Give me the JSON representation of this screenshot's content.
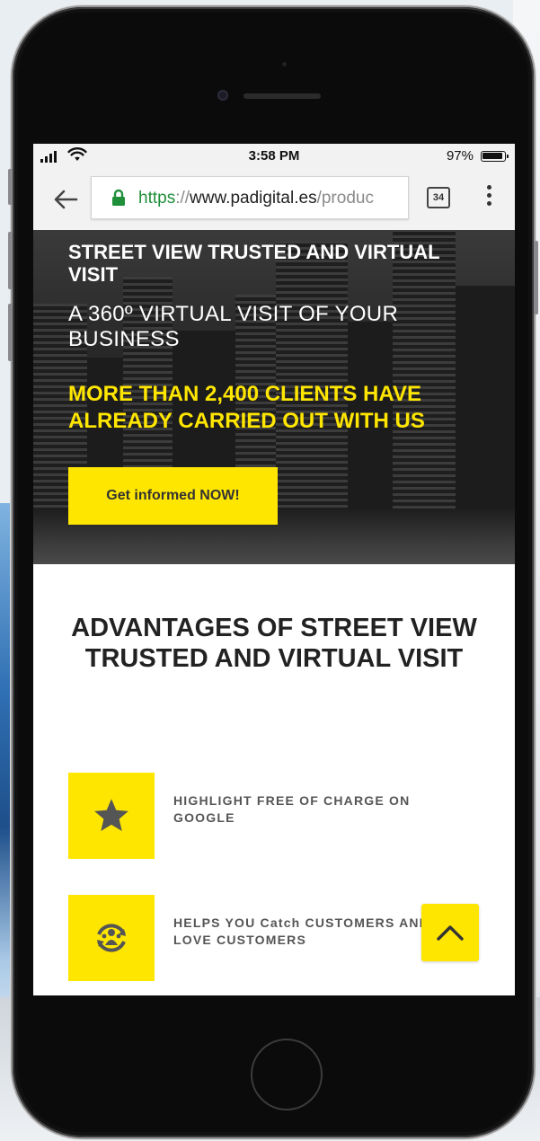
{
  "status_bar": {
    "time": "3:58 PM",
    "battery": "97%"
  },
  "browser": {
    "url_scheme": "https",
    "url_sep": "://",
    "url_host": "www.padigital.es",
    "url_path": "/produc",
    "tab_count": "34"
  },
  "hero": {
    "title": "STREET VIEW TRUSTED AND VIRTUAL VISIT",
    "subtitle": "A 360º VIRTUAL VISIT OF YOUR BUSINESS",
    "claim": "MORE THAN 2,400 CLIENTS HAVE ALREADY CARRIED OUT WITH US",
    "cta_label": "Get informed NOW!"
  },
  "advantages": {
    "title": "ADVANTAGES OF STREET VIEW TRUSTED AND VIRTUAL VISIT",
    "items": [
      {
        "label": "HIGHLIGHT FREE OF CHARGE ON GOOGLE",
        "icon": "star-icon"
      },
      {
        "label": "HELPS YOU Catch CUSTOMERS AND LOVE CUSTOMERS",
        "icon": "customer-loyalty-icon"
      }
    ]
  },
  "colors": {
    "accent": "#ffe600",
    "url_secure": "#1f8f3a"
  }
}
